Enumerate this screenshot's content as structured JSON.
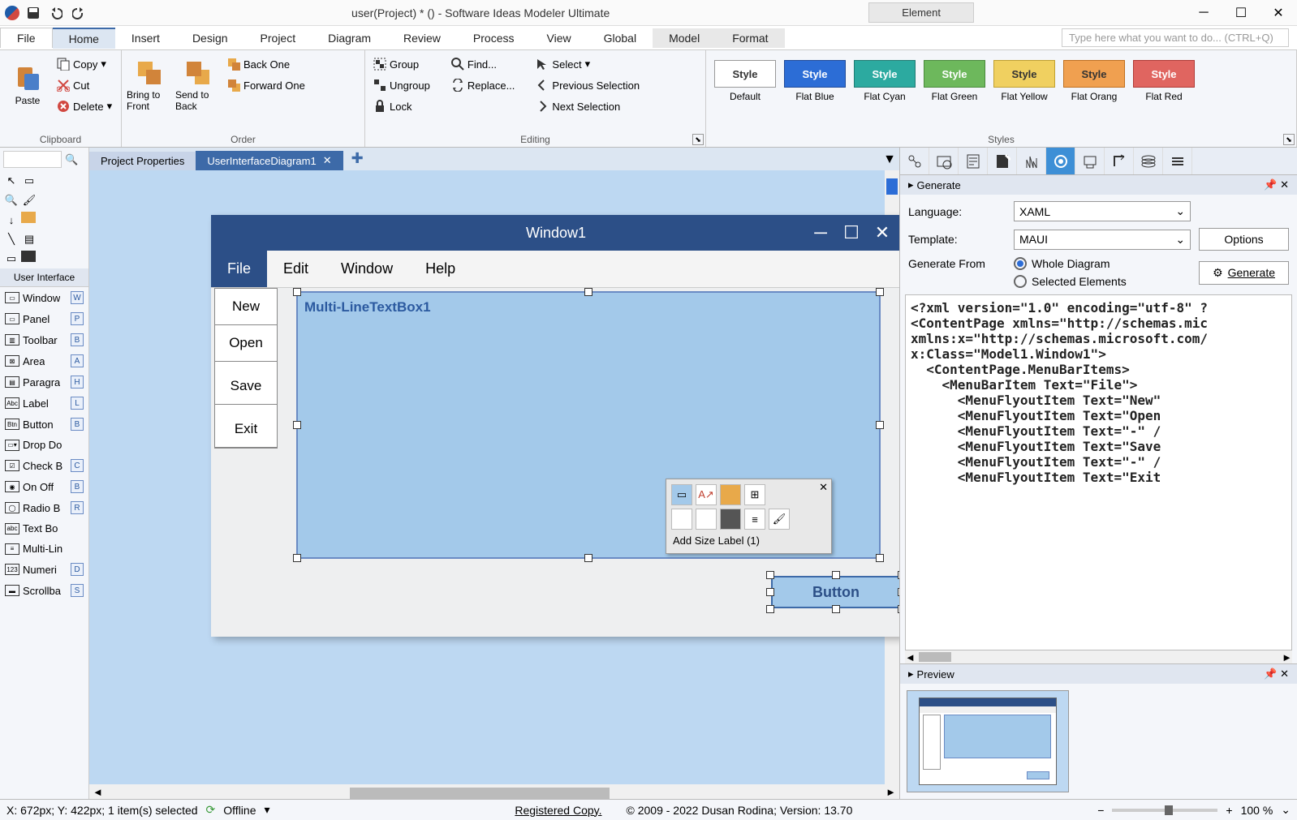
{
  "titlebar": {
    "title": "user(Project) * () - Software Ideas Modeler Ultimate",
    "context_tab": "Element"
  },
  "menubar": {
    "items": [
      "File",
      "Home",
      "Insert",
      "Design",
      "Project",
      "Diagram",
      "Review",
      "Process",
      "View",
      "Global",
      "Model",
      "Format"
    ],
    "search_placeholder": "Type here what you want to do...  (CTRL+Q)"
  },
  "ribbon": {
    "clipboard": {
      "title": "Clipboard",
      "paste": "Paste",
      "copy": "Copy",
      "cut": "Cut",
      "delete": "Delete"
    },
    "order": {
      "title": "Order",
      "bring_front": "Bring to Front",
      "send_back": "Send to Back",
      "back_one": "Back One",
      "forward_one": "Forward One"
    },
    "grouping": {
      "group": "Group",
      "ungroup": "Ungroup",
      "lock": "Lock"
    },
    "editing": {
      "title": "Editing",
      "find": "Find...",
      "replace": "Replace...",
      "select": "Select",
      "prev_sel": "Previous Selection",
      "next_sel": "Next Selection"
    },
    "styles": {
      "title": "Styles",
      "items": [
        {
          "name": "Default",
          "bg": "#ffffff",
          "border": "#999",
          "fg": "#333"
        },
        {
          "name": "Flat Blue",
          "bg": "#2c6dd6",
          "border": "#1e4a99",
          "fg": "#fff"
        },
        {
          "name": "Flat Cyan",
          "bg": "#2caaa0",
          "border": "#1e7a72",
          "fg": "#fff"
        },
        {
          "name": "Flat Green",
          "bg": "#6db85c",
          "border": "#4a8a3c",
          "fg": "#fff"
        },
        {
          "name": "Flat Yellow",
          "bg": "#f0d060",
          "border": "#c0a030",
          "fg": "#333"
        },
        {
          "name": "Flat Orang",
          "bg": "#f0a050",
          "border": "#c07020",
          "fg": "#333"
        },
        {
          "name": "Flat Red",
          "bg": "#e06560",
          "border": "#b03a35",
          "fg": "#fff"
        }
      ],
      "swatch_label": "Style"
    }
  },
  "toolbox": {
    "section": "User Interface",
    "items": [
      {
        "label": "Window",
        "key": "W"
      },
      {
        "label": "Panel",
        "key": "P"
      },
      {
        "label": "Toolbar",
        "key": "B"
      },
      {
        "label": "Area",
        "key": "A"
      },
      {
        "label": "Paragra",
        "key": "H"
      },
      {
        "label": "Label",
        "key": "L"
      },
      {
        "label": "Button",
        "key": "B"
      },
      {
        "label": "Drop Do",
        "key": ""
      },
      {
        "label": "Check B",
        "key": "C"
      },
      {
        "label": "On Off",
        "key": "B"
      },
      {
        "label": "Radio B",
        "key": "R"
      },
      {
        "label": "Text Bo",
        "key": ""
      },
      {
        "label": "Multi-Lin",
        "key": ""
      },
      {
        "label": "Numeri",
        "key": "D"
      },
      {
        "label": "Scrollba",
        "key": "S"
      }
    ]
  },
  "tabs": {
    "project_props": "Project Properties",
    "active": "UserInterfaceDiagram1"
  },
  "canvas": {
    "window_title": "Window1",
    "menus": [
      "File",
      "Edit",
      "Window",
      "Help"
    ],
    "dropdown": [
      "New",
      "Open",
      "Save",
      "Exit"
    ],
    "textbox_label": "Multi-LineTextBox1",
    "button_label": "Button"
  },
  "mini_toolbar": {
    "label": "Add Size Label (1)"
  },
  "generate": {
    "title": "Generate",
    "language_label": "Language:",
    "language_value": "XAML",
    "template_label": "Template:",
    "template_value": "MAUI",
    "options_btn": "Options",
    "from_label": "Generate From",
    "whole": "Whole Diagram",
    "selected": "Selected Elements",
    "generate_btn": "Generate",
    "code": "<?xml version=\"1.0\" encoding=\"utf-8\" ?\n<ContentPage xmlns=\"http://schemas.mic\nxmlns:x=\"http://schemas.microsoft.com/\nx:Class=\"Model1.Window1\">\n  <ContentPage.MenuBarItems>\n    <MenuBarItem Text=\"File\">\n      <MenuFlyoutItem Text=\"New\"\n      <MenuFlyoutItem Text=\"Open\n      <MenuFlyoutItem Text=\"-\" /\n      <MenuFlyoutItem Text=\"Save\n      <MenuFlyoutItem Text=\"-\" /\n      <MenuFlyoutItem Text=\"Exit"
  },
  "preview": {
    "title": "Preview"
  },
  "statusbar": {
    "coords": "X: 672px; Y: 422px; 1 item(s) selected",
    "offline": "Offline",
    "registered": "Registered Copy.",
    "copyright": "© 2009 - 2022 Dusan Rodina; Version: 13.70",
    "zoom": "100 %"
  }
}
